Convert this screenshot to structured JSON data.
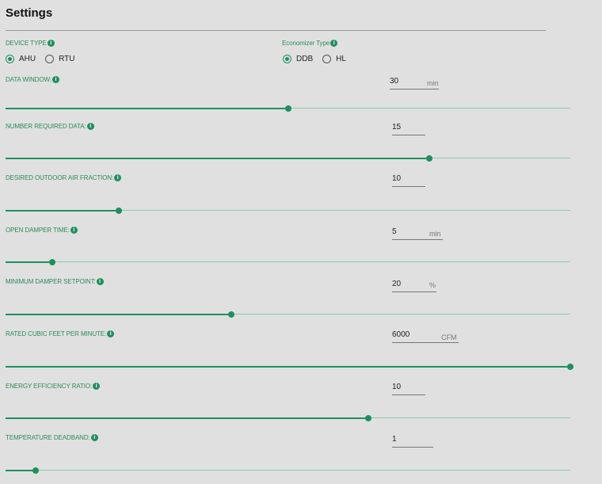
{
  "settings": {
    "title": "Settings",
    "device_type": {
      "label": "DEVICE TYPE",
      "options": [
        {
          "label": "AHU",
          "checked": true
        },
        {
          "label": "RTU",
          "checked": false
        }
      ]
    },
    "economizer_type": {
      "label": "Economizer Type",
      "options": [
        {
          "label": "DDB",
          "checked": true
        },
        {
          "label": "HL",
          "checked": false
        }
      ]
    },
    "info_glyph": "i",
    "accent_color": "#1e9060",
    "fields": [
      {
        "label": "DATA WINDOW:",
        "value": "30",
        "unit": "min",
        "slider_fraction": 0.5
      },
      {
        "label": "NUMBER REQUIRED DATA:",
        "value": "15",
        "unit": "",
        "slider_fraction": 0.75
      },
      {
        "label": "DESIRED OUTDOOR AIR FRACTION:",
        "value": "10",
        "unit": "",
        "slider_fraction": 0.2
      },
      {
        "label": "OPEN DAMPER TIME:",
        "value": "5",
        "unit": "min",
        "slider_fraction": 0.083
      },
      {
        "label": "MINIMUM DAMPER SETPOINT:",
        "value": "20",
        "unit": "%",
        "slider_fraction": 0.4
      },
      {
        "label": "RATED CUBIC FEET PER MINUTE:",
        "value": "6000",
        "unit": "CFM",
        "slider_fraction": 1.0
      },
      {
        "label": "ENERGY EFFICIENCY RATIO:",
        "value": "10",
        "unit": "",
        "slider_fraction": 0.643
      },
      {
        "label": "TEMPERATURE DEADBAND:",
        "value": "1",
        "unit": "",
        "slider_fraction": 0.053
      }
    ]
  }
}
